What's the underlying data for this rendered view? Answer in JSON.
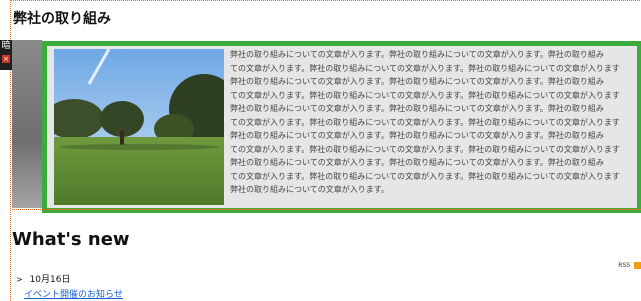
{
  "section_title": "弊社の取り組み",
  "side_tab": {
    "label": "暗",
    "close_glyph": "×"
  },
  "feature": {
    "photo_alt": "park with trees and lawn",
    "body": "弊社の取り組みについての文章が入ります。弊社の取り組みについての文章が入ります。弊社の取り組み\nての文章が入ります。弊社の取り組みについての文章が入ります。弊社の取り組みについての文章が入ります\n弊社の取り組みについての文章が入ります。弊社の取り組みについての文章が入ります。弊社の取り組み\nての文章が入ります。弊社の取り組みについての文章が入ります。弊社の取り組みについての文章が入ります\n弊社の取り組みについての文章が入ります。弊社の取り組みについての文章が入ります。弊社の取り組み\nての文章が入ります。弊社の取り組みについての文章が入ります。弊社の取り組みについての文章が入ります\n弊社の取り組みについての文章が入ります。弊社の取り組みについての文章が入ります。弊社の取り組み\nての文章が入ります。弊社の取り組みについての文章が入ります。弊社の取り組みについての文章が入ります\n弊社の取り組みについての文章が入ります。弊社の取り組みについての文章が入ります。弊社の取り組み\nての文章が入ります。弊社の取り組みについての文章が入ります。弊社の取り組みについての文章が入ります\n弊社の取り組みについての文章が入ります。"
  },
  "whats_new": {
    "title": "What's new",
    "rss_label": "RSS",
    "items": [
      {
        "arrow": ">",
        "date": "10月16日",
        "link": "イベント開催のお知らせ"
      }
    ]
  },
  "colors": {
    "highlight": "#3bab3b",
    "dotted_guide": "#e07020",
    "link": "#1a5fd0"
  }
}
